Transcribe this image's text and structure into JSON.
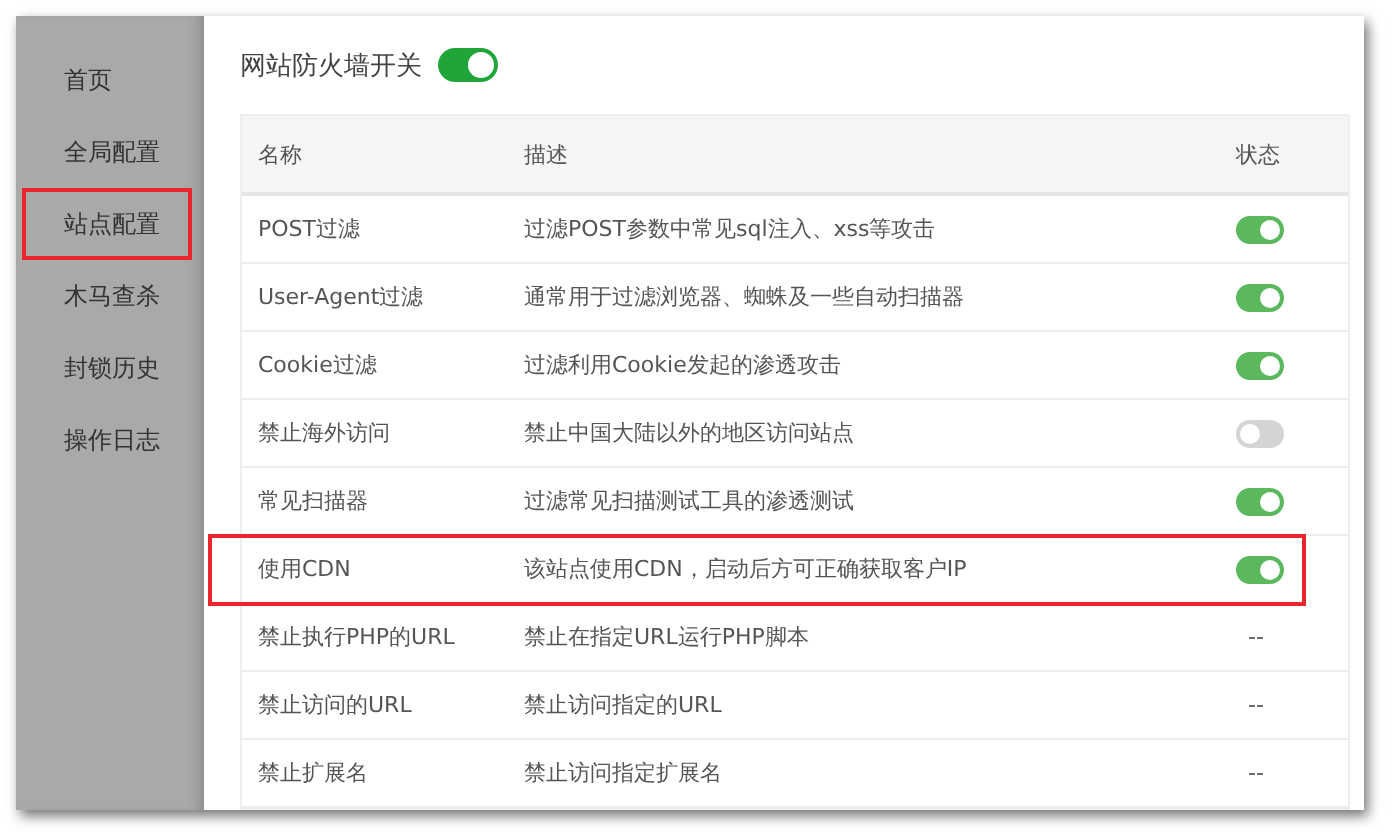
{
  "sidebar": {
    "items": [
      {
        "label": "首页",
        "highlighted": false
      },
      {
        "label": "全局配置",
        "highlighted": false
      },
      {
        "label": "站点配置",
        "highlighted": true
      },
      {
        "label": "木马查杀",
        "highlighted": false
      },
      {
        "label": "封锁历史",
        "highlighted": false
      },
      {
        "label": "操作日志",
        "highlighted": false
      }
    ]
  },
  "firewall": {
    "label": "网站防火墙开关",
    "on": true
  },
  "table": {
    "columns": [
      "名称",
      "描述",
      "状态"
    ],
    "rows": [
      {
        "name": "POST过滤",
        "description": "过滤POST参数中常见sql注入、xss等攻击",
        "kind": "toggle",
        "on": true,
        "highlighted": false
      },
      {
        "name": "User-Agent过滤",
        "description": "通常用于过滤浏览器、蜘蛛及一些自动扫描器",
        "kind": "toggle",
        "on": true,
        "highlighted": false
      },
      {
        "name": "Cookie过滤",
        "description": "过滤利用Cookie发起的渗透攻击",
        "kind": "toggle",
        "on": true,
        "highlighted": false
      },
      {
        "name": "禁止海外访问",
        "description": "禁止中国大陆以外的地区访问站点",
        "kind": "toggle",
        "on": false,
        "highlighted": false
      },
      {
        "name": "常见扫描器",
        "description": "过滤常见扫描测试工具的渗透测试",
        "kind": "toggle",
        "on": true,
        "highlighted": false
      },
      {
        "name": "使用CDN",
        "description": "该站点使用CDN，启动后方可正确获取客户IP",
        "kind": "toggle",
        "on": true,
        "highlighted": true
      },
      {
        "name": "禁止执行PHP的URL",
        "description": "禁止在指定URL运行PHP脚本",
        "kind": "text",
        "status": "--",
        "highlighted": false
      },
      {
        "name": "禁止访问的URL",
        "description": "禁止访问指定的URL",
        "kind": "text",
        "status": "--",
        "highlighted": false
      },
      {
        "name": "禁止扩展名",
        "description": "禁止访问指定扩展名",
        "kind": "text",
        "status": "--",
        "highlighted": false
      }
    ]
  }
}
